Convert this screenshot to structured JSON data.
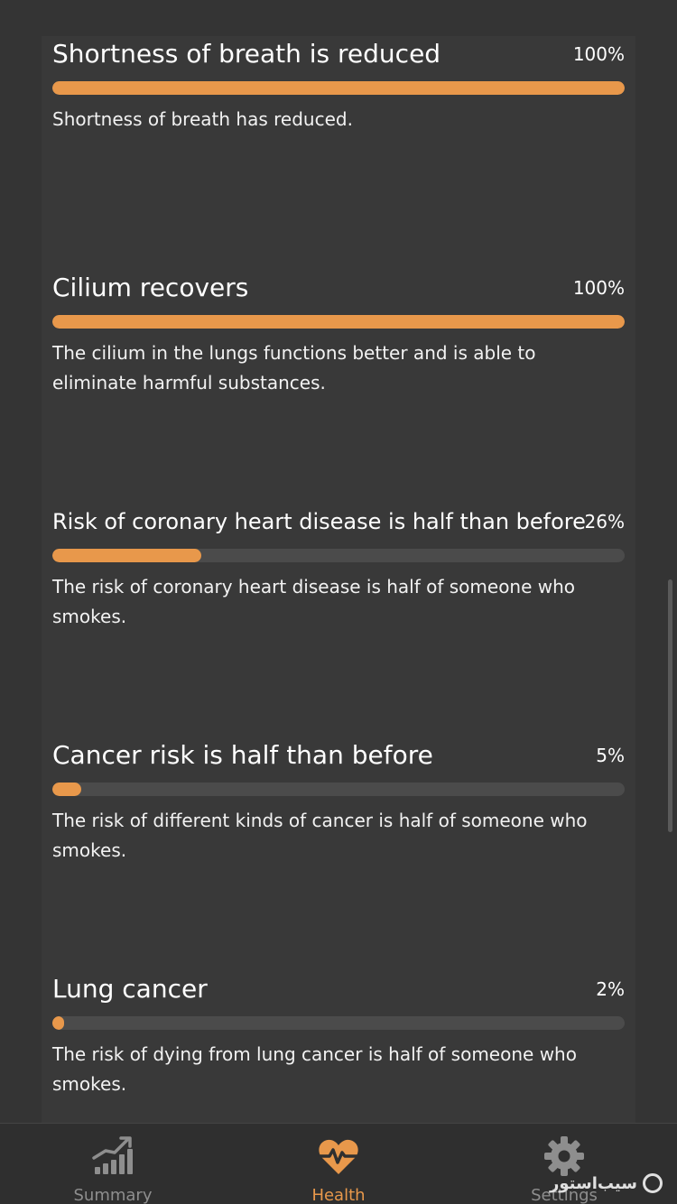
{
  "colors": {
    "accent": "#e8984b",
    "track": "#4b4b4b",
    "card": "#393939",
    "background": "#343434",
    "tab_inactive": "#8e8e8e"
  },
  "milestones": [
    {
      "title": "Shortness of breath is reduced",
      "percent_label": "100%",
      "progress": 1.0,
      "description": "Shortness of breath has reduced."
    },
    {
      "title": "Cilium recovers",
      "percent_label": "100%",
      "progress": 1.0,
      "description": "The cilium in the lungs functions better and is able to eliminate harmful substances."
    },
    {
      "title": "Risk of coronary heart disease is half than before",
      "percent_label": "26%",
      "progress": 0.26,
      "description": "The risk of coronary heart disease is half of someone who smokes."
    },
    {
      "title": "Cancer risk is half than before",
      "percent_label": "5%",
      "progress": 0.05,
      "description": "The risk of different kinds of cancer is half of someone who smokes."
    },
    {
      "title": "Lung cancer",
      "percent_label": "2%",
      "progress": 0.02,
      "description": "The risk of dying from lung cancer is half of someone who smokes."
    }
  ],
  "tabbar": {
    "tabs": [
      {
        "label": "Summary",
        "icon": "chart-up-icon",
        "active": false
      },
      {
        "label": "Health",
        "icon": "heart-pulse-icon",
        "active": true
      },
      {
        "label": "Settings",
        "icon": "gear-icon",
        "active": false
      }
    ]
  },
  "watermark": {
    "text": "سیب‌استور",
    "icon": "store-logo-icon"
  }
}
